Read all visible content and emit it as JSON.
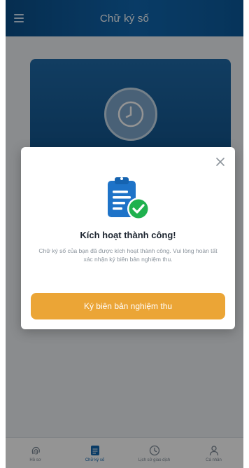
{
  "header": {
    "title": "Chữ ký số",
    "menu_icon": "hamburger-menu-icon"
  },
  "background_card": {
    "icon": "clock-icon"
  },
  "bottom_nav": {
    "items": [
      {
        "label": "Hồ sơ",
        "icon": "fingerprint-icon",
        "active": false
      },
      {
        "label": "Chữ ký số",
        "icon": "signature-doc-icon",
        "active": true
      },
      {
        "label": "Lịch sử giao dịch",
        "icon": "clock-icon",
        "active": false
      },
      {
        "label": "Cá nhân",
        "icon": "user-icon",
        "active": false
      }
    ]
  },
  "modal": {
    "title": "Kích hoạt thành công!",
    "message": "Chữ ký số của bạn đã được kích hoạt thành công. Vui lòng hoàn tất xác nhận ký biên bản nghiệm thu.",
    "primary_button": "Ký biên bản nghiệm thu",
    "close_icon": "close-icon",
    "illustration_icon": "clipboard-check-icon"
  },
  "colors": {
    "header": "#1067b0",
    "card": "#1a5f9c",
    "primary_button": "#eba536",
    "success_badge": "#1fb14e",
    "clipboard": "#1e73c8"
  }
}
